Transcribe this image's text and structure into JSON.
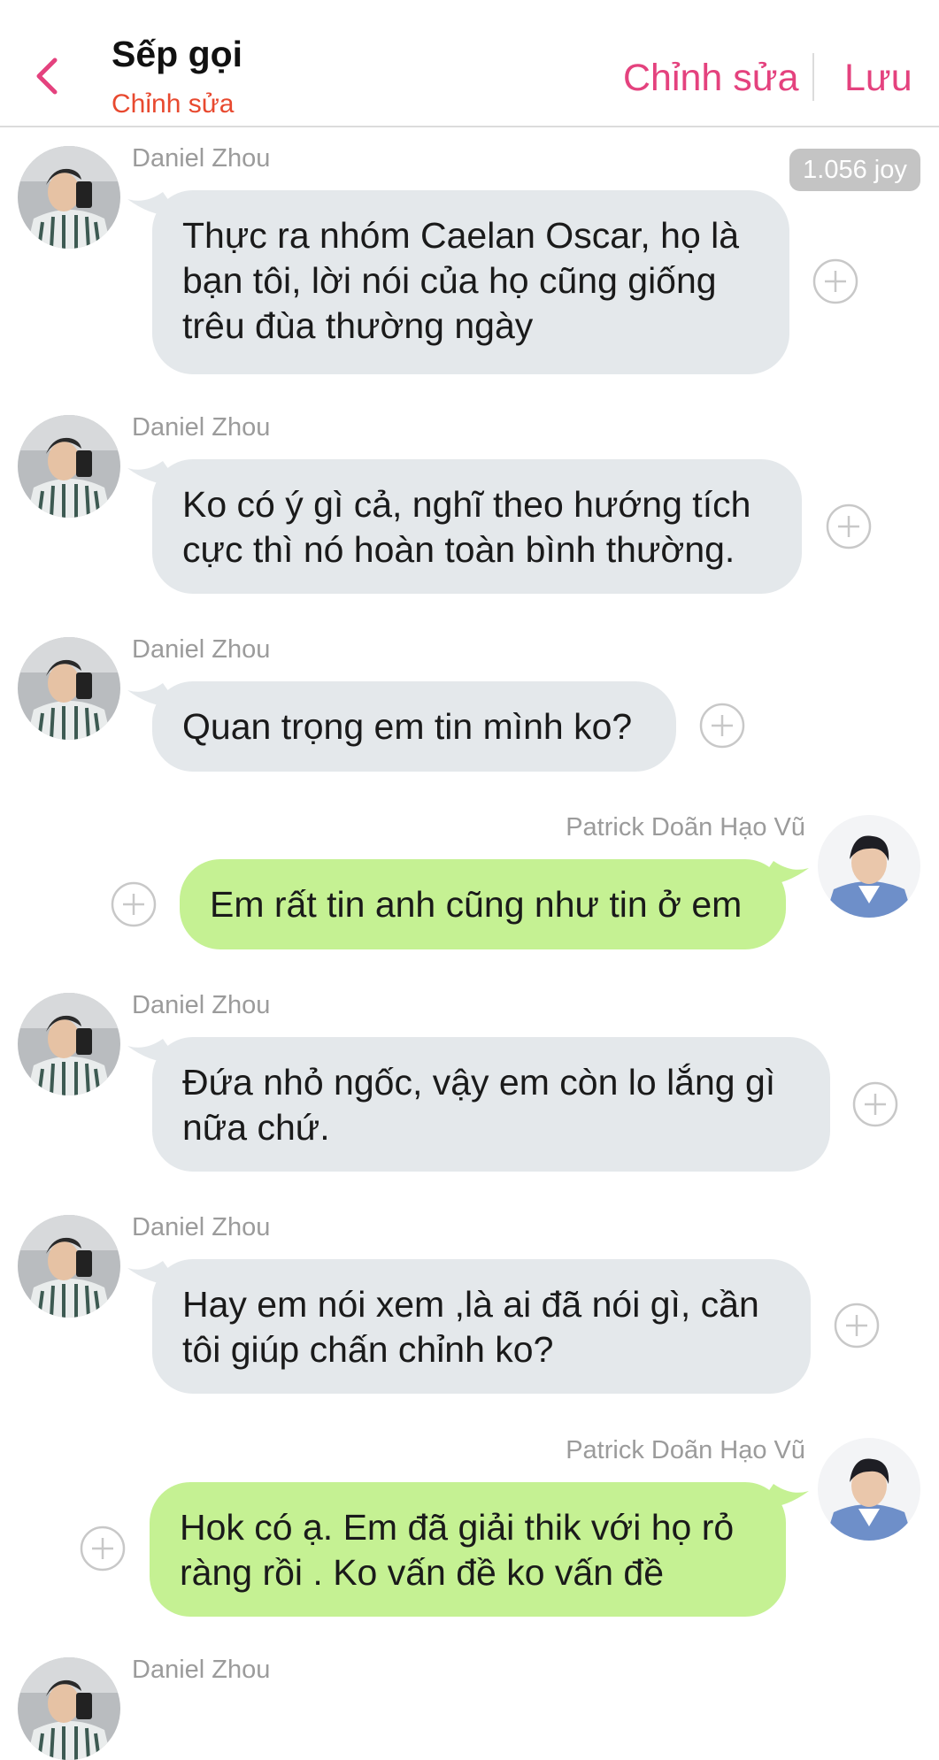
{
  "header": {
    "title": "Sếp gọi",
    "subtitle": "Chỉnh sửa",
    "edit_label": "Chỉnh sửa",
    "save_label": "Lưu"
  },
  "badge": "1.056 joy",
  "messages": [
    {
      "sender": "Daniel Zhou",
      "side": "left",
      "lines": [
        "Thực ra nhóm Caelan Oscar, họ là",
        "bạn tôi, lời nói của họ cũng giống",
        "trêu đùa thường ngày"
      ]
    },
    {
      "sender": "Daniel Zhou",
      "side": "left",
      "lines": [
        "Ko có ý gì cả, nghĩ theo hướng tích",
        "cực thì nó hoàn toàn bình thường."
      ]
    },
    {
      "sender": "Daniel Zhou",
      "side": "left",
      "lines": [
        "Quan trọng em tin mình ko?"
      ]
    },
    {
      "sender": "Patrick Doãn Hạo Vũ",
      "side": "right",
      "lines": [
        "Em rất tin anh cũng như tin ở em"
      ]
    },
    {
      "sender": "Daniel Zhou",
      "side": "left",
      "lines": [
        "Đứa nhỏ ngốc, vậy em còn lo lắng gì",
        "nữa chứ."
      ]
    },
    {
      "sender": "Daniel Zhou",
      "side": "left",
      "lines": [
        "Hay em nói xem ,là ai đã nói gì, cần",
        "tôi giúp chấn chỉnh ko?"
      ]
    },
    {
      "sender": "Patrick Doãn Hạo Vũ",
      "side": "right",
      "lines": [
        "Hok có ạ. Em đã giải thik với họ rỏ",
        "ràng rồi . Ko vấn đề ko vấn đề"
      ]
    },
    {
      "sender": "Daniel Zhou",
      "side": "left",
      "lines": []
    }
  ],
  "colors": {
    "accent": "#e4427e",
    "subtitle": "#e8492f",
    "bubble_incoming": "#e4e8eb",
    "bubble_outgoing": "#c5f193",
    "sender_name": "#9b9b9b"
  },
  "icons": {
    "back": "chevron-left-icon",
    "add_reaction": "plus-circle-icon"
  }
}
